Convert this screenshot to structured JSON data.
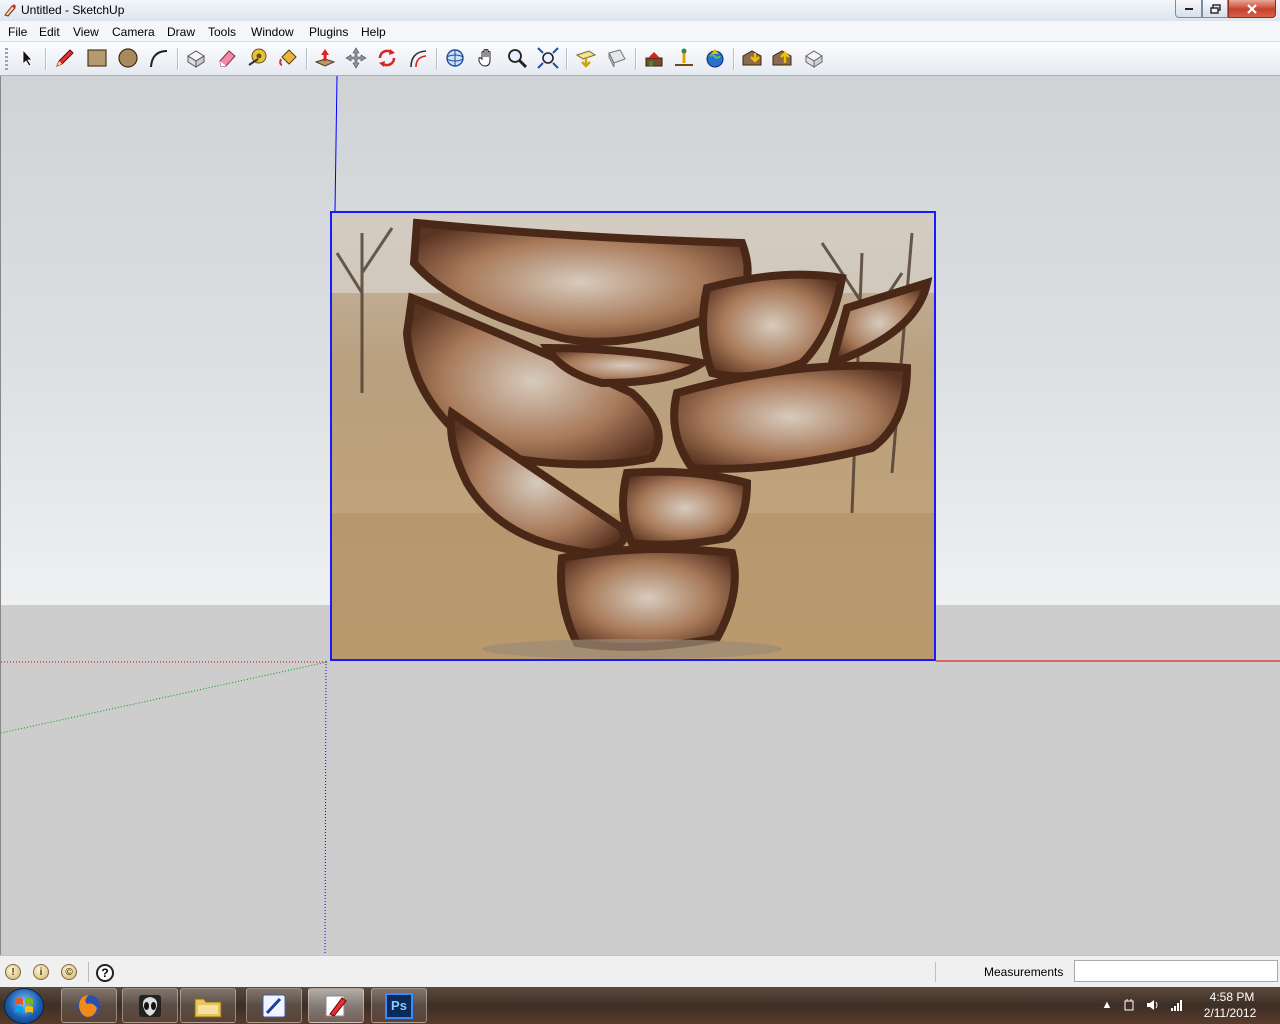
{
  "window": {
    "title": "Untitled - SketchUp"
  },
  "menu": [
    "File",
    "Edit",
    "View",
    "Camera",
    "Draw",
    "Tools",
    "Window",
    "Plugins",
    "Help"
  ],
  "toolbar": {
    "tools": [
      {
        "name": "select-tool",
        "icon": "arrow-cursor-icon"
      },
      {
        "name": "line-tool",
        "icon": "pencil-icon"
      },
      {
        "name": "rectangle-tool",
        "icon": "rectangle-icon"
      },
      {
        "name": "circle-tool",
        "icon": "circle-icon"
      },
      {
        "name": "arc-tool",
        "icon": "arc-icon"
      },
      {
        "name": "make-component-tool",
        "icon": "component-icon"
      },
      {
        "name": "eraser-tool",
        "icon": "eraser-icon"
      },
      {
        "name": "tape-measure-tool",
        "icon": "tape-measure-icon"
      },
      {
        "name": "paint-bucket-tool",
        "icon": "paint-bucket-icon"
      },
      {
        "name": "push-pull-tool",
        "icon": "push-pull-icon"
      },
      {
        "name": "move-tool",
        "icon": "move-icon"
      },
      {
        "name": "rotate-tool",
        "icon": "rotate-icon"
      },
      {
        "name": "offset-tool",
        "icon": "offset-icon"
      },
      {
        "name": "orbit-tool",
        "icon": "orbit-icon"
      },
      {
        "name": "pan-tool",
        "icon": "hand-icon"
      },
      {
        "name": "zoom-tool",
        "icon": "magnifier-icon"
      },
      {
        "name": "zoom-extents-tool",
        "icon": "zoom-extents-icon"
      },
      {
        "name": "previous-view-tool",
        "icon": "previous-icon"
      },
      {
        "name": "next-view-tool",
        "icon": "next-icon"
      },
      {
        "name": "add-location-tool",
        "icon": "location-icon"
      },
      {
        "name": "toggle-terrain-tool",
        "icon": "terrain-icon"
      },
      {
        "name": "google-earth-tool",
        "icon": "globe-icon"
      },
      {
        "name": "get-models-tool",
        "icon": "warehouse-down-icon"
      },
      {
        "name": "share-model-tool",
        "icon": "warehouse-up-icon"
      },
      {
        "name": "share-component-tool",
        "icon": "share-component-icon"
      }
    ]
  },
  "statusbar": {
    "measurements_label": "Measurements",
    "measurements_value": "",
    "status_icons": [
      "geo-location-icon",
      "credits-icon",
      "copyright-icon"
    ]
  },
  "taskbar": {
    "apps": [
      {
        "name": "firefox",
        "icon": "firefox-icon"
      },
      {
        "name": "alien-app",
        "icon": "alien-icon"
      },
      {
        "name": "file-explorer",
        "icon": "folder-icon"
      },
      {
        "name": "pen-app",
        "icon": "pen-icon"
      },
      {
        "name": "sketchup",
        "icon": "sketchup-icon",
        "active": true
      },
      {
        "name": "photoshop",
        "icon": "photoshop-icon",
        "label": "Ps"
      }
    ],
    "clock_time": "4:58 PM",
    "clock_date": "2/11/2012"
  },
  "colors": {
    "axis_red": "#e00000",
    "axis_green": "#00a000",
    "axis_blue": "#0000ff",
    "selection_blue": "#1a1aff"
  }
}
